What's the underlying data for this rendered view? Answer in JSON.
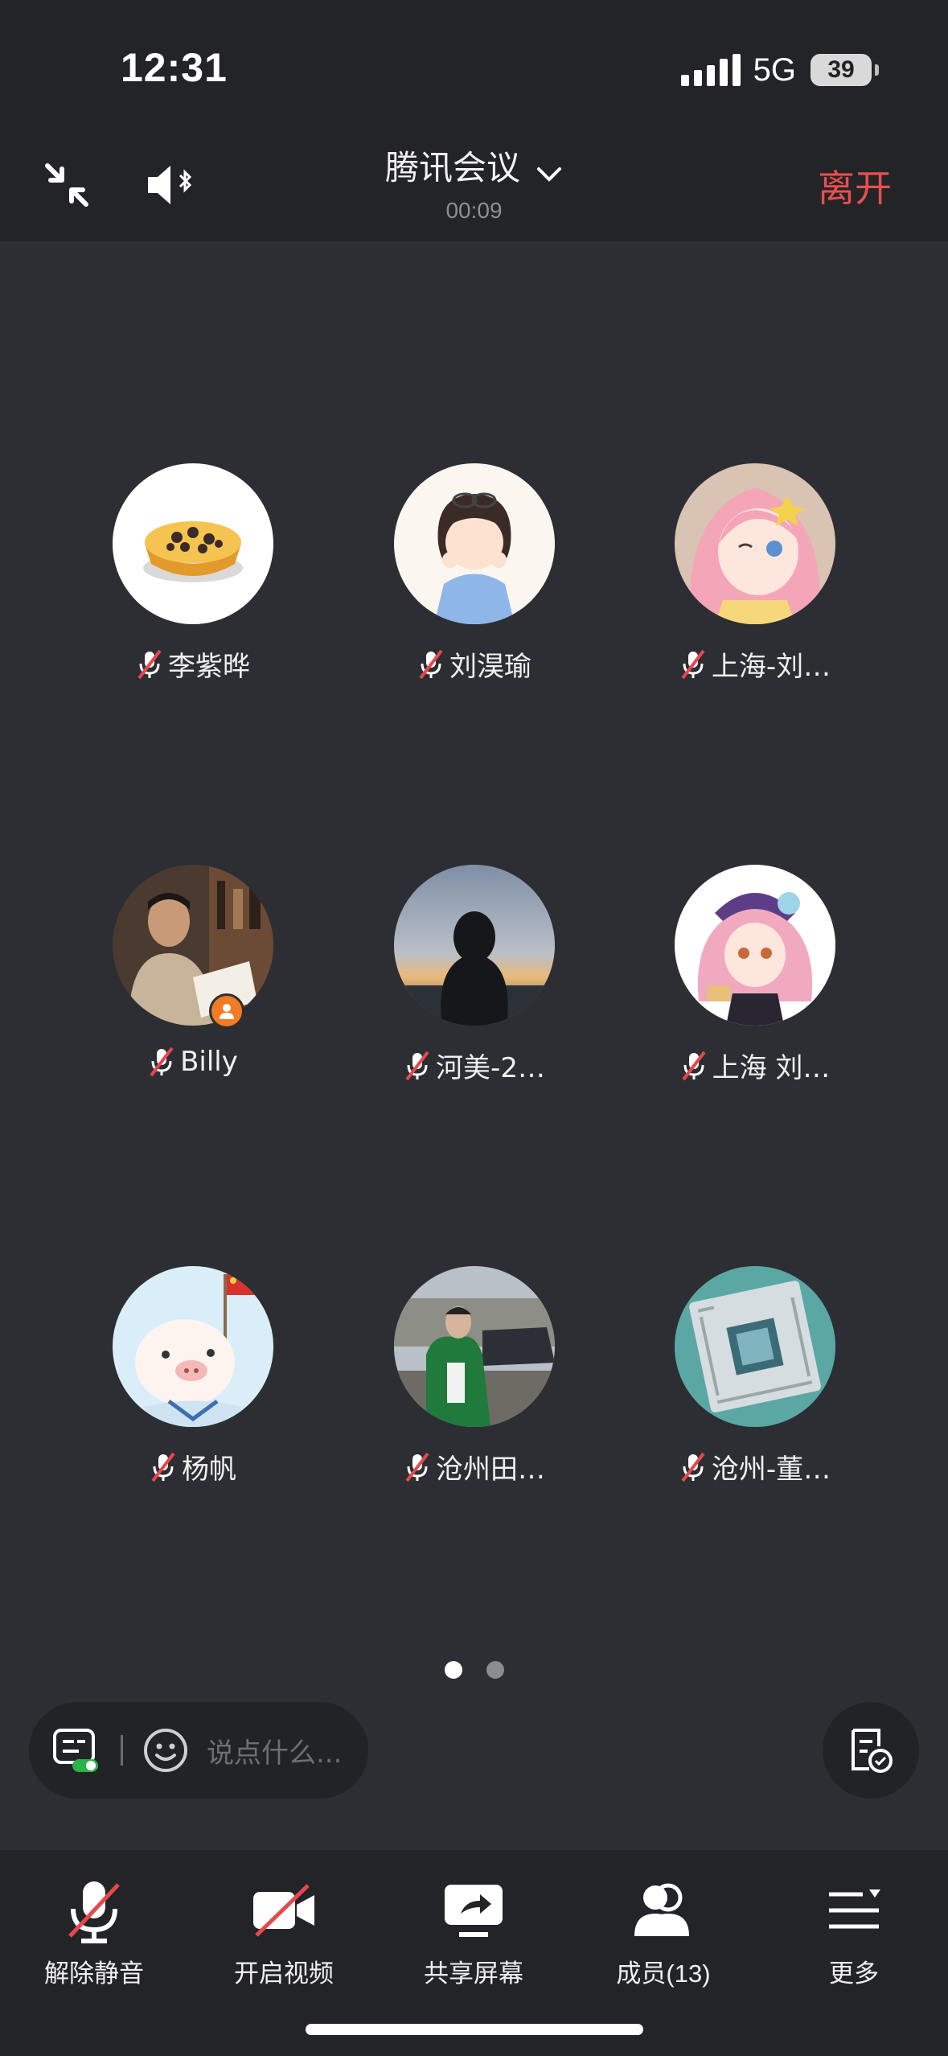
{
  "status_bar": {
    "time": "12:31",
    "network": "5G",
    "battery": "39"
  },
  "header": {
    "title": "腾讯会议",
    "timer": "00:09",
    "leave_label": "离开"
  },
  "participants": [
    {
      "name": "李紫晔",
      "muted": true,
      "avatar": "egg-tart-avatar"
    },
    {
      "name": "刘淏瑜",
      "muted": true,
      "avatar": "cartoon-girl-avatar"
    },
    {
      "name": "上海-刘…",
      "muted": true,
      "avatar": "anime-girl-avatar"
    },
    {
      "name": "Billy",
      "muted": true,
      "avatar": "reading-man-avatar",
      "host": true
    },
    {
      "name": "河美-2…",
      "muted": true,
      "avatar": "hooded-person-sunset-avatar"
    },
    {
      "name": "上海 刘…",
      "muted": true,
      "avatar": "anime-character-avatar"
    },
    {
      "name": "杨帆",
      "muted": true,
      "avatar": "pig-with-flag-avatar"
    },
    {
      "name": "沧州田…",
      "muted": true,
      "avatar": "person-with-car-avatar"
    },
    {
      "name": "沧州-董…",
      "muted": true,
      "avatar": "cpu-chip-avatar"
    }
  ],
  "pagination": {
    "pages": 2,
    "current": 1
  },
  "chat": {
    "placeholder": "说点什么..."
  },
  "toolbar": {
    "unmute_label": "解除静音",
    "video_label": "开启视频",
    "share_label": "共享屏幕",
    "members_label": "成员(13)",
    "more_label": "更多"
  },
  "colors": {
    "leave": "#e94f4f",
    "host_badge": "#f37b22",
    "mute_slash": "#e5484d"
  }
}
